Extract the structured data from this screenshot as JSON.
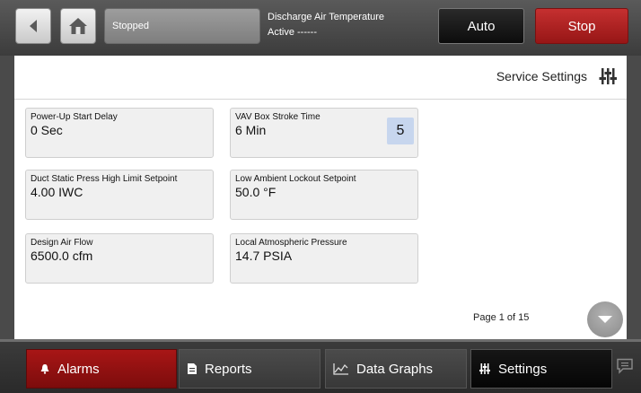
{
  "header": {
    "status": "Stopped",
    "point_name": "Discharge Air Temperature",
    "point_state": "Active ------",
    "auto_label": "Auto",
    "stop_label": "Stop"
  },
  "service": {
    "label": "Service Settings"
  },
  "cards": [
    {
      "label": "Power-Up Start Delay",
      "value": "0 Sec"
    },
    {
      "label": "VAV Box Stroke Time",
      "value": "6 Min",
      "badge": "5"
    },
    {
      "label": "Duct Static Press High Limit Setpoint",
      "value": "4.00 IWC"
    },
    {
      "label": "Low Ambient Lockout Setpoint",
      "value": "50.0 °F"
    },
    {
      "label": "Design Air Flow",
      "value": "6500.0 cfm"
    },
    {
      "label": "Local Atmospheric Pressure",
      "value": "14.7 PSIA"
    }
  ],
  "pagination": {
    "label": "Page 1 of 15"
  },
  "nav": {
    "alarms": "Alarms",
    "reports": "Reports",
    "graphs": "Data Graphs",
    "settings": "Settings"
  },
  "colors": {
    "stop": "#b52222",
    "alarms": "#981212",
    "badge": "#c7d6ee"
  },
  "icons": [
    "back-icon",
    "home-icon",
    "service-settings-icon",
    "chevron-down-icon",
    "bell-icon",
    "document-icon",
    "graph-icon",
    "settings-icon",
    "chat-icon"
  ]
}
